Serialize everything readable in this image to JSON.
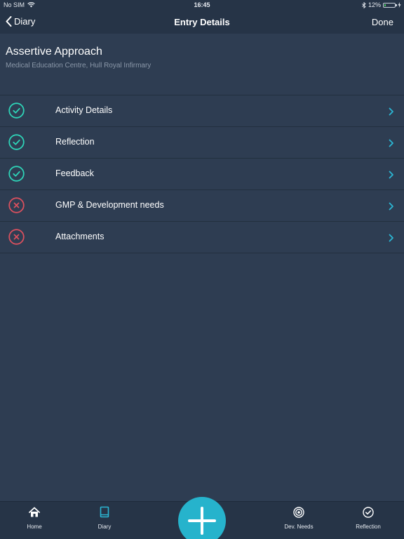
{
  "status_bar": {
    "carrier": "No SIM",
    "time": "16:45",
    "battery_percent_label": "12%",
    "battery_level": 0.12
  },
  "nav": {
    "back_label": "Diary",
    "title": "Entry Details",
    "done_label": "Done"
  },
  "entry": {
    "title": "Assertive Approach",
    "location": "Medical Education Centre, Hull Royal Infirmary"
  },
  "sections": [
    {
      "label": "Activity Details",
      "status": "complete",
      "icon": "check-circle-icon"
    },
    {
      "label": "Reflection",
      "status": "complete",
      "icon": "check-circle-icon"
    },
    {
      "label": "Feedback",
      "status": "complete",
      "icon": "check-circle-icon"
    },
    {
      "label": "GMP & Development needs",
      "status": "incomplete",
      "icon": "cross-circle-icon"
    },
    {
      "label": "Attachments",
      "status": "incomplete",
      "icon": "cross-circle-icon"
    }
  ],
  "tabs": [
    {
      "label": "Home",
      "icon": "home-icon",
      "active": false
    },
    {
      "label": "Diary",
      "icon": "book-icon",
      "active": true
    },
    {
      "label": "Dev. Needs",
      "icon": "target-icon",
      "active": false
    },
    {
      "label": "Reflection",
      "icon": "check-circle-icon",
      "active": false
    }
  ],
  "fab": {
    "icon": "plus-icon"
  },
  "colors": {
    "background": "#2e3d52",
    "bar": "#263447",
    "complete": "#2ed3b7",
    "incomplete": "#d9505e",
    "accent": "#2bb7d4",
    "fab": "#26b3cc"
  }
}
